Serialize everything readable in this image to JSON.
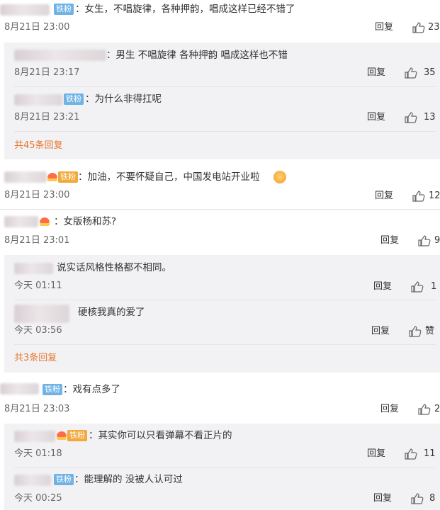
{
  "labels": {
    "reply": "回复",
    "tiefen": "铁粉"
  },
  "colors": {
    "badge_blue": "#6fb2e5",
    "badge_gold": "#f2a93a",
    "more_orange": "#e8752b",
    "sub_bg": "#f2f2f5"
  },
  "threads": [
    {
      "text": "：女生，不唱旋律，各种押韵，唱成这样已经不错了",
      "time": "8月21日 23:00",
      "likes": "23",
      "replies": [
        {
          "text": "：男生 不唱旋律 各种押韵 唱成这样也不错",
          "time": "8月21日 23:17",
          "likes": "35"
        },
        {
          "text": "：为什么非得扛呢",
          "time": "8月21日 23:21",
          "likes": "13"
        }
      ],
      "more": "共45条回复"
    },
    {
      "text": "：加油，不要怀疑自己，中国发电站开业啦",
      "time": "8月21日 23:00",
      "likes": "12"
    },
    {
      "text": "：女版杨和苏?",
      "time": "8月21日 23:01",
      "likes": "9",
      "replies": [
        {
          "text": "说实话风格性格都不相同。",
          "time": "今天 01:11",
          "likes": "1"
        },
        {
          "text": "硬核我真的爱了",
          "time": "今天 03:56",
          "likes": "赞"
        }
      ],
      "more": "共3条回复"
    },
    {
      "text": "：戏有点多了",
      "time": "8月21日 23:03",
      "likes": "2",
      "replies": [
        {
          "text": "：其实你可以只看弹幕不看正片的",
          "time": "今天 01:18",
          "likes": "11"
        },
        {
          "text": "：能理解的 没被人认可过",
          "time": "今天 00:25",
          "likes": "8"
        }
      ]
    }
  ]
}
